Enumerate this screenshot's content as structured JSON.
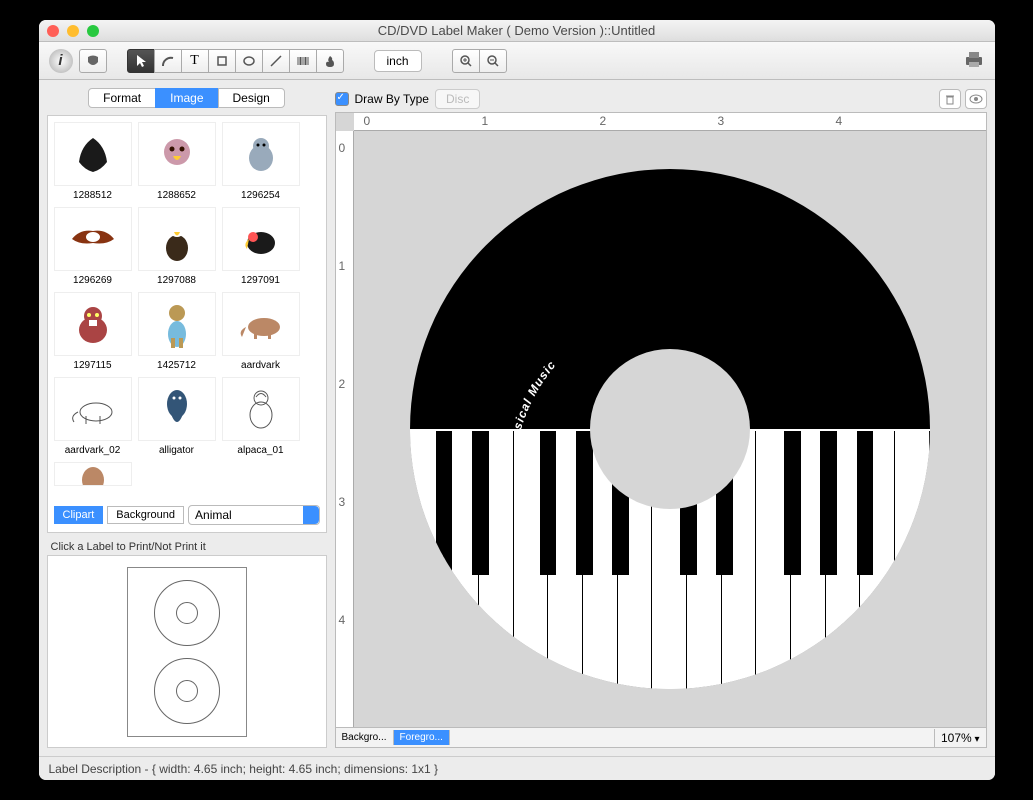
{
  "window": {
    "title": "CD/DVD Label Maker ( Demo Version )::Untitled"
  },
  "toolbar": {
    "unit": "inch"
  },
  "sidebar": {
    "tabs": [
      "Format",
      "Image",
      "Design"
    ],
    "active_tab": 1,
    "thumbs": [
      "1288512",
      "1288652",
      "1296254",
      "1296269",
      "1297088",
      "1297091",
      "1297115",
      "1425712",
      "aardvark",
      "aardvark_02",
      "alligator",
      "alpaca_01"
    ],
    "subtabs": [
      "Clipart",
      "Background"
    ],
    "active_subtab": 0,
    "category": "Animal",
    "label_hint": "Click a Label to Print/Not Print it"
  },
  "canvas": {
    "draw_by_type": "Draw By Type",
    "disc_btn": "Disc",
    "ruler_marks": [
      "0",
      "1",
      "2",
      "3",
      "4"
    ],
    "label_text": "Classical Music",
    "layers": [
      "Backgro...",
      "Foregro..."
    ],
    "active_layer": 1,
    "zoom": "107%"
  },
  "footer": {
    "desc": "Label Description - { width: 4.65 inch; height: 4.65 inch; dimensions: 1x1 }"
  }
}
